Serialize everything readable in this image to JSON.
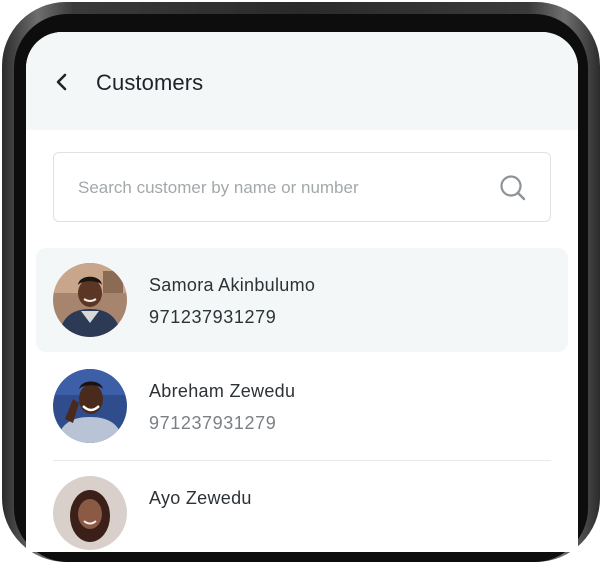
{
  "header": {
    "title": "Customers",
    "back_icon": "chevron-left-icon"
  },
  "search": {
    "placeholder": "Search customer by name or number",
    "value": "",
    "icon": "search-icon"
  },
  "customers": [
    {
      "name": "Samora Akinbulumo",
      "phone": "971237931279",
      "selected": true
    },
    {
      "name": "Abreham Zewedu",
      "phone": "971237931279",
      "selected": false
    },
    {
      "name": "Ayo Zewedu",
      "phone": "",
      "selected": false
    }
  ],
  "colors": {
    "header_bg": "#f3f7f7",
    "selected_row_bg": "#f3f7f7",
    "text_primary": "#2d3236",
    "text_muted": "#7a8085",
    "placeholder": "#a3a8ab"
  }
}
